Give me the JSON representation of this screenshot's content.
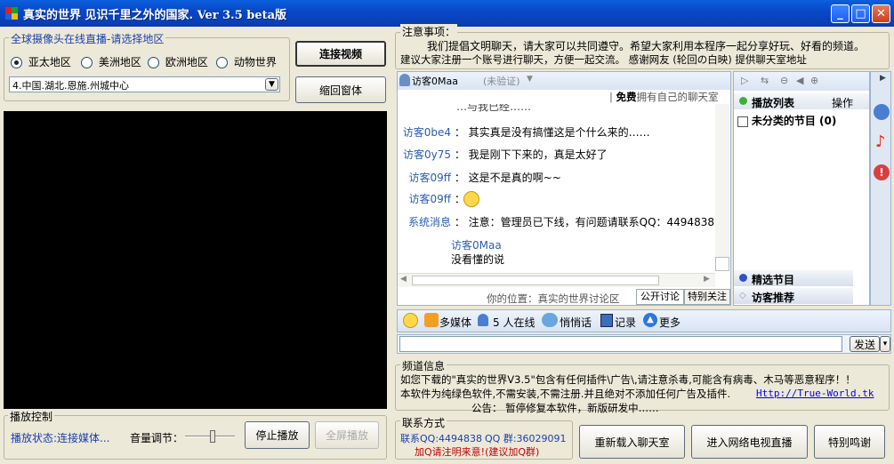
{
  "window": {
    "title": "真实的世界 见识千里之外的国家. Ver 3.5 beta版",
    "min": "_",
    "max": "□",
    "close": "✕"
  },
  "camera": {
    "group_label": "全球摄像头在线直播-请选择地区",
    "regions": [
      "亚太地区",
      "美洲地区",
      "欧洲地区",
      "动物世界"
    ],
    "selected_region": 0,
    "location_value": "4.中国.湖北.恩施.州城中心",
    "connect_button": "连接视频",
    "shrink_button": "缩回窗体"
  },
  "playback": {
    "group_label": "播放控制",
    "status_text": "播放状态:连接媒体...",
    "volume_label": "音量调节：",
    "volume_level": 0.55,
    "stop_button": "停止播放",
    "fullscreen_button": "全屏播放"
  },
  "notice": {
    "title": "注意事项：",
    "line1": "我们提倡文明聊天，请大家可以共同遵守。希望大家利用本程序一起分享好玩、好看的频道。",
    "line2": "建议大家注册一个账号进行聊天，方便一起交流。    感谢网友 (轮回の白映) 提供聊天室地址"
  },
  "chat": {
    "user": "访客0Maa",
    "verify": "(未验证)",
    "free_prefix": "免费",
    "free_suffix": "拥有自己的聊天室",
    "messages": [
      {
        "name": "访客0be4",
        "text": "其实真是没有搞懂这是个什么来的……"
      },
      {
        "name": "访客0y75",
        "text": "我是刚下下来的，真是太好了"
      },
      {
        "name": "访客09ff",
        "text": "这是不是真的啊~~"
      },
      {
        "name": "访客09ff",
        "text": ""
      },
      {
        "name": "系统消息",
        "text": "注意：管理员已下线，有问题请联系QQ：4494838"
      }
    ],
    "partial_top": "…与我已经……",
    "self_name": "访客0Maa",
    "self_text": "没看懂的说",
    "location_label": "你的位置：真实的世界讨论区",
    "tab_public": "公开讨论",
    "tab_special": "特别关注",
    "side": {
      "playlist": "播放列表",
      "operate": "操作",
      "unclassified": "未分类的节目 (0)",
      "featured": "精选节目",
      "visitor": "访客推荐"
    },
    "toolbar": {
      "multimedia": "多媒体",
      "online": "5 人在线",
      "whisper": "悄悄话",
      "record": "记录",
      "more": "更多"
    },
    "input_value": "",
    "send_button": "发送",
    "send_arrow": "▾"
  },
  "channel_info": {
    "title": "频道信息",
    "line1": "如您下载的\"真实的世界V3.5\"包含有任何插件\\广告\\,请注意杀毒,可能含有病毒、木马等恶意程序！！",
    "line2": "本软件为纯绿色软件,不需安装,不需注册.并且绝对不添加任何广告及插件.",
    "url": "Http://True-World.tk",
    "line3": "公告：  暂停修复本软件，新版研发中……"
  },
  "contact": {
    "title": "联系方式",
    "qq": "联系QQ:4494838",
    "group": "QQ  群:36029091",
    "note": "加Q请注明来意!(建议加Q群)",
    "reload_button": "重新载入聊天室",
    "tv_button": "进入网络电视直播",
    "thanks_button": "特别鸣谢"
  }
}
